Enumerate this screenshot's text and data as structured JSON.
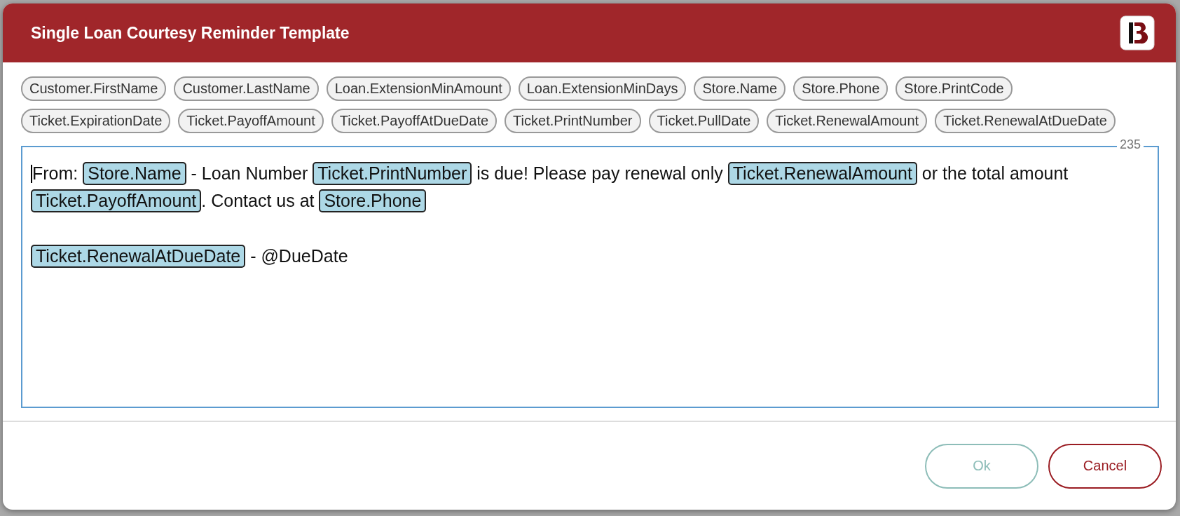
{
  "dialog": {
    "title": "Single Loan Courtesy Reminder Template"
  },
  "field_rows": [
    [
      {
        "label": "Customer.FirstName"
      },
      {
        "label": "Customer.LastName"
      },
      {
        "label": "Loan.ExtensionMinAmount"
      },
      {
        "label": "Loan.ExtensionMinDays"
      },
      {
        "label": "Store.Name"
      },
      {
        "label": "Store.Phone"
      },
      {
        "label": "Store.PrintCode"
      }
    ],
    [
      {
        "label": "Ticket.ExpirationDate"
      },
      {
        "label": "Ticket.PayoffAmount"
      },
      {
        "label": "Ticket.PayoffAtDueDate"
      },
      {
        "label": "Ticket.PrintNumber"
      },
      {
        "label": "Ticket.PullDate"
      },
      {
        "label": "Ticket.RenewalAmount"
      },
      {
        "label": "Ticket.RenewalAtDueDate"
      }
    ]
  ],
  "editor": {
    "counter": "235",
    "paragraphs": [
      {
        "lines": [
          [
            {
              "kind": "text",
              "text": "From: "
            },
            {
              "kind": "token",
              "text": "Store.Name"
            },
            {
              "kind": "text",
              "text": " - Loan Number "
            },
            {
              "kind": "token",
              "text": "Ticket.PrintNumber"
            },
            {
              "kind": "text",
              "text": " is due! Please pay renewal only "
            },
            {
              "kind": "token",
              "text": "Ticket.RenewalAmount"
            },
            {
              "kind": "text",
              "text": " or the total amount"
            }
          ],
          [
            {
              "kind": "token",
              "text": "Ticket.PayoffAmount"
            },
            {
              "kind": "text",
              "text": ". Contact us at "
            },
            {
              "kind": "token",
              "text": "Store.Phone"
            }
          ]
        ]
      },
      {
        "lines": [
          [
            {
              "kind": "token",
              "text": "Ticket.RenewalAtDueDate"
            },
            {
              "kind": "text",
              "text": " - @DueDate"
            }
          ]
        ]
      }
    ]
  },
  "buttons": [
    {
      "label": "Ok",
      "kind": "primary",
      "disabled": true
    },
    {
      "label": "Cancel",
      "kind": "cancel",
      "disabled": false
    }
  ]
}
